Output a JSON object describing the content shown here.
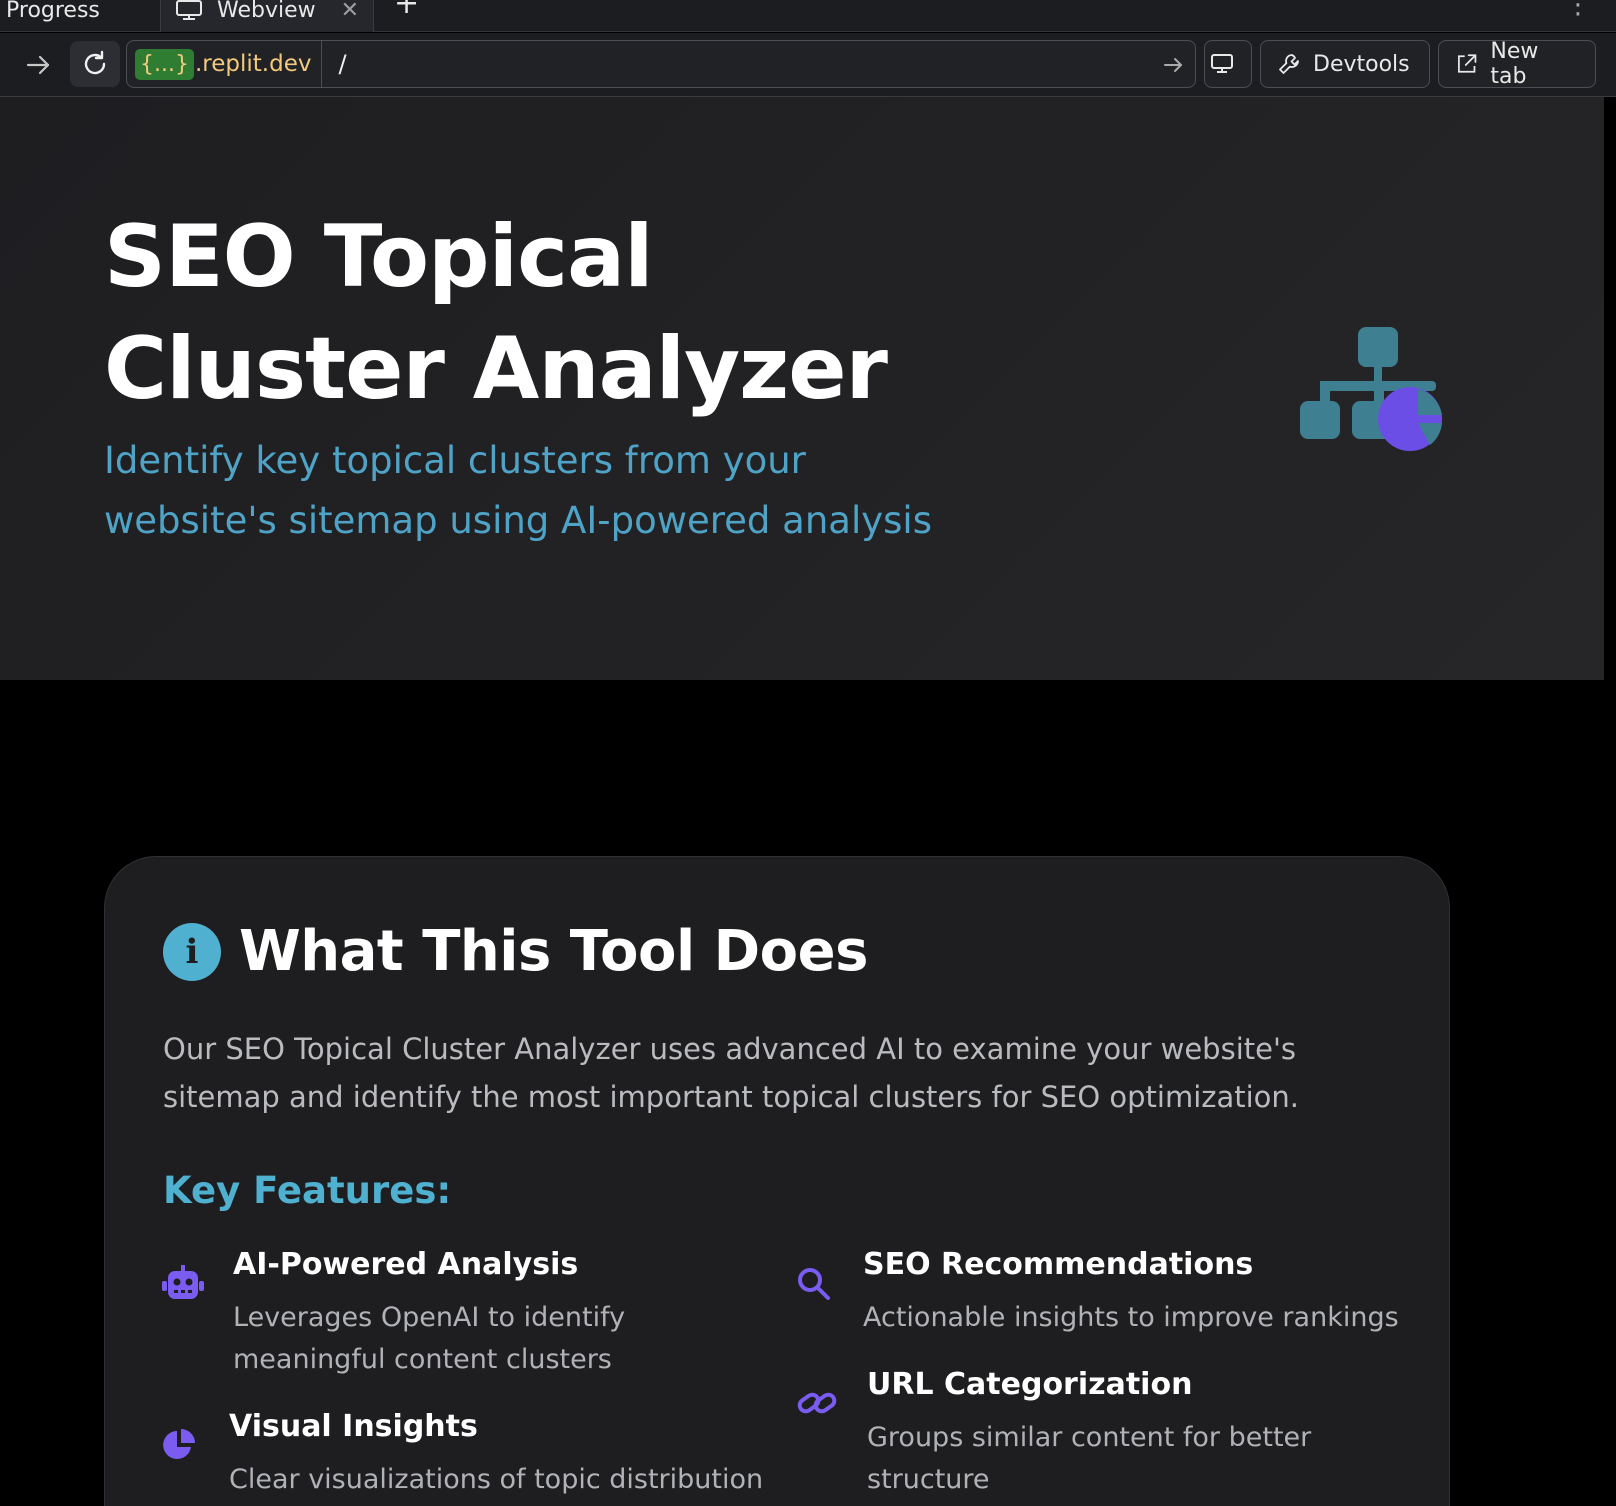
{
  "browser": {
    "tabs": [
      {
        "label": "Progress"
      },
      {
        "label": "Webview",
        "icon": "monitor-icon"
      }
    ],
    "url": {
      "badge": "{...}",
      "domain": ".replit.dev",
      "path": "/"
    },
    "buttons": {
      "devtools": "Devtools",
      "new_tab": "New tab"
    }
  },
  "hero": {
    "title": "SEO Topical Cluster Analyzer",
    "subtitle": "Identify key topical clusters from your website's sitemap using AI-powered analysis",
    "icon": "sitemap-pie-icon"
  },
  "card": {
    "title": "What This Tool Does",
    "description": "Our SEO Topical Cluster Analyzer uses advanced AI to examine your website's sitemap and identify the most important topical clusters for SEO optimization.",
    "features_heading": "Key Features:",
    "features": [
      {
        "title": "AI-Powered Analysis",
        "description": "Leverages OpenAI to identify meaningful content clusters",
        "icon": "robot-icon"
      },
      {
        "title": "SEO Recommendations",
        "description": "Actionable insights to improve rankings",
        "icon": "search-icon"
      },
      {
        "title": "URL Categorization",
        "description": "Groups similar content for better structure",
        "icon": "link-icon"
      },
      {
        "title": "Visual Insights",
        "description": "Clear visualizations of topic distribution",
        "icon": "pie-chart-icon"
      }
    ]
  },
  "colors": {
    "accent_blue": "#4fb0d0",
    "accent_purple": "#7b5cf0",
    "hero_icon_teal": "#3f7f92",
    "url_yellow": "#f2c97d",
    "badge_green": "#2e7d32"
  }
}
